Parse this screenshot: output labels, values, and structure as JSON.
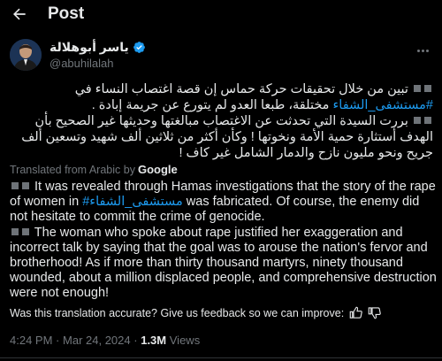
{
  "header": {
    "title": "Post",
    "back_icon": "arrow-left-icon"
  },
  "author": {
    "display_name": "ياسر أبوهلالة",
    "handle": "@abuhilalah",
    "verified": true,
    "verified_color": "#1d9bf0"
  },
  "tweet": {
    "arabic": [
      {
        "part1": "تبين من خلال تحقيقات حركة حماس إن قصة اغتصاب النساء في",
        "hashtag": "#مستشفى_الشفاء",
        "part2": "مختلقة، طبعا العدو لم يتورع عن جريمة إبادة ."
      },
      {
        "text": "بررت السيدة التي تحدثت عن الاغتصاب مبالغتها وحديثها غير الصحيح بأن الهدف أستثارة حمية الأمة ونخوتها ! وكأن أكثر من ثلاثين ألف شهيد وتسعين ألف جريح ونحو مليون نازح والدمار الشامل غير كاف !"
      }
    ],
    "translated_label": "Translated from Arabic by",
    "translator": "Google",
    "english": [
      {
        "part1": "It was revealed through Hamas investigations that the story of the rape of women in",
        "hashtag": "#مستشفى_الشفاء",
        "part2": "was fabricated. Of course, the enemy did not hesitate to commit the crime of genocide."
      },
      {
        "text": "The woman who spoke about rape justified her exaggeration and incorrect talk by saying that the goal was to arouse the nation's fervor and brotherhood! As if more than thirty thousand martyrs, ninety thousand wounded, about a million displaced people, and comprehensive destruction were not enough!"
      }
    ],
    "feedback_text": "Was this translation accurate? Give us feedback so we can improve:",
    "time": "4:24 PM",
    "date": "Mar 24, 2024",
    "separator": "·",
    "views_count": "1.3M",
    "views_label": "Views"
  },
  "colors": {
    "background": "#000000",
    "text": "#e7e9ea",
    "muted": "#71767b",
    "link": "#1d9bf0"
  }
}
